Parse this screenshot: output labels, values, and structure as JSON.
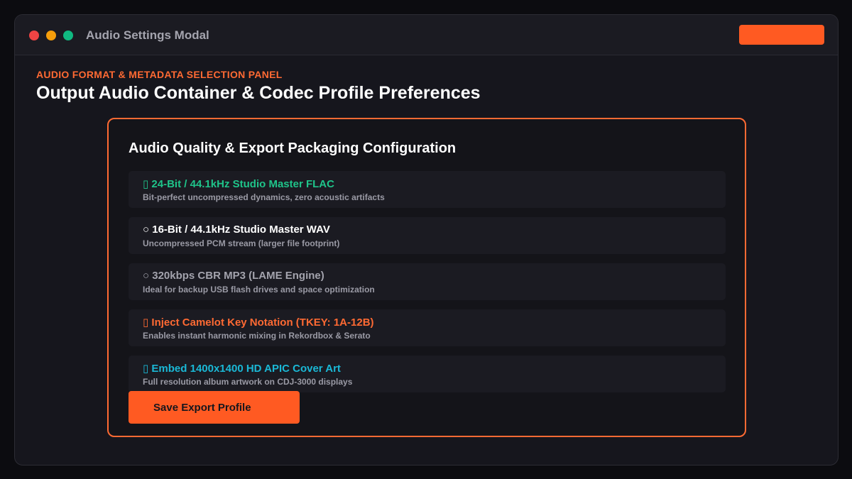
{
  "window": {
    "title": "Audio Settings Modal",
    "accent_color": "#ff5a22"
  },
  "header": {
    "eyebrow": "AUDIO FORMAT & METADATA SELECTION PANEL",
    "title": "Output Audio Container & Codec Profile Preferences"
  },
  "panel": {
    "title": "Audio Quality & Export Packaging Configuration",
    "options": [
      {
        "label": "▯ 24-Bit / 44.1kHz Studio Master FLAC",
        "desc": "Bit-perfect uncompressed dynamics, zero acoustic artifacts",
        "color": "#1fc48a",
        "icon": "checkbox-icon"
      },
      {
        "label": "○ 16-Bit / 44.1kHz Studio Master WAV",
        "desc": "Uncompressed PCM stream (larger file footprint)",
        "color": "#ffffff",
        "icon": "radio-icon"
      },
      {
        "label": "○ 320kbps CBR MP3 (LAME Engine)",
        "desc": "Ideal for backup USB flash drives and space optimization",
        "color": "#a3a3ad",
        "icon": "radio-icon"
      },
      {
        "label": "▯ Inject Camelot Key Notation (TKEY: 1A-12B)",
        "desc": "Enables instant harmonic mixing in Rekordbox & Serato",
        "color": "#ff6a33",
        "icon": "checkbox-icon"
      },
      {
        "label": "▯ Embed 1400x1400 HD APIC Cover Art",
        "desc": "Full resolution album artwork on CDJ-3000 displays",
        "color": "#1ab8d6",
        "icon": "checkbox-icon"
      }
    ],
    "save_label": "Save Export Profile"
  }
}
